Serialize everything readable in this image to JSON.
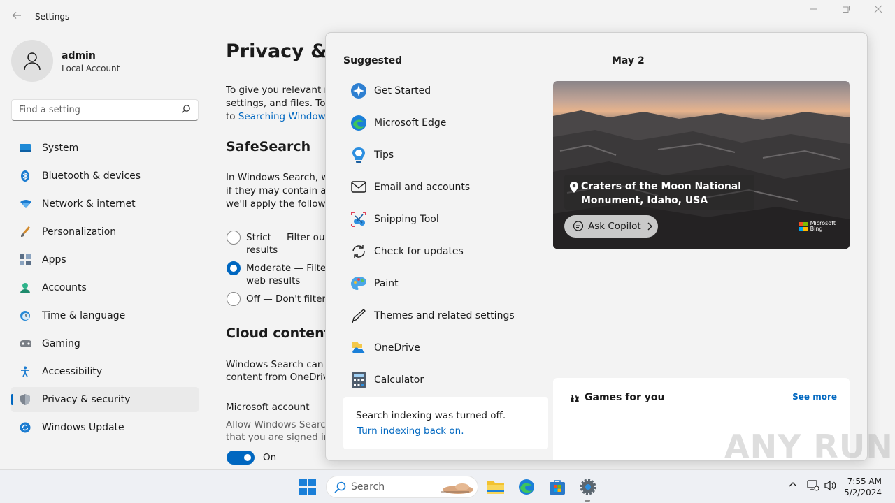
{
  "window": {
    "title": "Settings",
    "controls": [
      "minimize",
      "restore",
      "close"
    ]
  },
  "user": {
    "name": "admin",
    "account_type": "Local Account"
  },
  "search": {
    "placeholder": "Find a setting"
  },
  "sidebar": {
    "items": [
      {
        "label": "System",
        "icon": "system-icon",
        "active": false
      },
      {
        "label": "Bluetooth & devices",
        "icon": "bluetooth-icon",
        "active": false
      },
      {
        "label": "Network & internet",
        "icon": "wifi-icon",
        "active": false
      },
      {
        "label": "Personalization",
        "icon": "brush-icon",
        "active": false
      },
      {
        "label": "Apps",
        "icon": "apps-icon",
        "active": false
      },
      {
        "label": "Accounts",
        "icon": "person-icon",
        "active": false
      },
      {
        "label": "Time & language",
        "icon": "clock-globe-icon",
        "active": false
      },
      {
        "label": "Gaming",
        "icon": "gamepad-icon",
        "active": false
      },
      {
        "label": "Accessibility",
        "icon": "accessibility-icon",
        "active": false
      },
      {
        "label": "Privacy & security",
        "icon": "shield-icon",
        "active": true
      },
      {
        "label": "Windows Update",
        "icon": "update-icon",
        "active": false
      }
    ]
  },
  "content": {
    "title": "Privacy & se",
    "intro": [
      "To give you relevant res",
      "settings, and files. To ch"
    ],
    "intro_to": "to ",
    "intro_link": "Searching Windows",
    "safesearch_title": "SafeSearch",
    "safesearch_desc": [
      "In Windows Search, we",
      "if they may contain adu",
      "we'll apply the followin"
    ],
    "radios": [
      {
        "line1": "Strict — Filter out a",
        "line2": "results",
        "checked": false
      },
      {
        "line1": "Moderate — Filter",
        "line2": "web results",
        "checked": true
      },
      {
        "line1": "Off — Don't filter a",
        "line2": "",
        "checked": false
      }
    ],
    "cloud_title": "Cloud content s",
    "cloud_desc": [
      "Windows Search can pe",
      "content from OneDrive"
    ],
    "ms_account_title": "Microsoft account",
    "ms_account_desc": [
      "Allow Windows Search",
      "that you are signed in t"
    ],
    "toggle_label": "On"
  },
  "flyout": {
    "suggested_title": "Suggested",
    "suggested": [
      {
        "label": "Get Started",
        "icon": "get-started-icon"
      },
      {
        "label": "Microsoft Edge",
        "icon": "edge-icon"
      },
      {
        "label": "Tips",
        "icon": "tips-icon"
      },
      {
        "label": "Email and accounts",
        "icon": "mail-icon"
      },
      {
        "label": "Snipping Tool",
        "icon": "snipping-tool-icon"
      },
      {
        "label": "Check for updates",
        "icon": "refresh-icon"
      },
      {
        "label": "Paint",
        "icon": "paint-icon"
      },
      {
        "label": "Themes and related settings",
        "icon": "pen-icon"
      },
      {
        "label": "OneDrive",
        "icon": "onedrive-icon"
      },
      {
        "label": "Calculator",
        "icon": "calculator-icon"
      }
    ],
    "indexing_message": "Search indexing was turned off.",
    "indexing_link": "Turn indexing back on.",
    "date": "May 2",
    "location": "Craters of the Moon National Monument, Idaho, USA",
    "copilot_label": "Ask Copilot",
    "bing_line1": "Microsoft",
    "bing_line2": "Bing",
    "games_title": "Games for you",
    "see_more": "See more"
  },
  "watermark": "ANY RUN",
  "taskbar": {
    "search_placeholder": "Search",
    "apps": [
      "file-explorer-icon",
      "edge-icon",
      "store-icon",
      "settings-icon"
    ],
    "time": "7:55 AM",
    "date": "5/2/2024"
  },
  "colors": {
    "accent": "#0067c0",
    "background": "#f3f3f3",
    "card": "#ffffff"
  }
}
